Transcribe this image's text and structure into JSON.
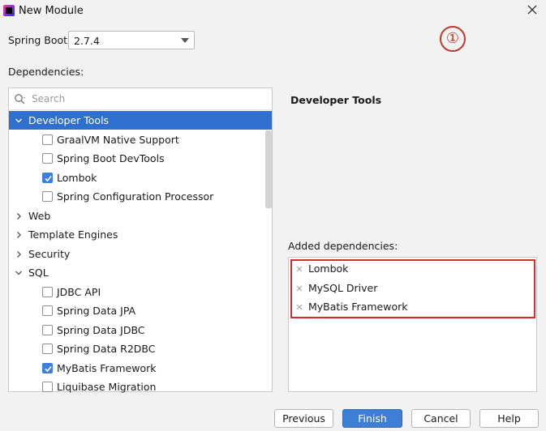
{
  "window": {
    "title": "New Module"
  },
  "spring_boot": {
    "label": "Spring Boot:",
    "value": "2.7.4"
  },
  "annotation": {
    "marker": "①"
  },
  "dependencies": {
    "label": "Dependencies:",
    "search_placeholder": "Search",
    "tree": [
      {
        "label": "Developer Tools",
        "type": "group",
        "expanded": true,
        "selected": true
      },
      {
        "label": "GraalVM Native Support",
        "type": "item",
        "checked": false
      },
      {
        "label": "Spring Boot DevTools",
        "type": "item",
        "checked": false
      },
      {
        "label": "Lombok",
        "type": "item",
        "checked": true
      },
      {
        "label": "Spring Configuration Processor",
        "type": "item",
        "checked": false
      },
      {
        "label": "Web",
        "type": "group",
        "expanded": false
      },
      {
        "label": "Template Engines",
        "type": "group",
        "expanded": false
      },
      {
        "label": "Security",
        "type": "group",
        "expanded": false
      },
      {
        "label": "SQL",
        "type": "group",
        "expanded": true
      },
      {
        "label": "JDBC API",
        "type": "item",
        "checked": false
      },
      {
        "label": "Spring Data JPA",
        "type": "item",
        "checked": false
      },
      {
        "label": "Spring Data JDBC",
        "type": "item",
        "checked": false
      },
      {
        "label": "Spring Data R2DBC",
        "type": "item",
        "checked": false
      },
      {
        "label": "MyBatis Framework",
        "type": "item",
        "checked": true
      },
      {
        "label": "Liquibase Migration",
        "type": "item",
        "checked": false
      }
    ]
  },
  "detail": {
    "title": "Developer Tools"
  },
  "added": {
    "label": "Added dependencies:",
    "items": [
      "Lombok",
      "MySQL Driver",
      "MyBatis Framework"
    ]
  },
  "buttons": {
    "previous": "Previous",
    "finish": "Finish",
    "cancel": "Cancel",
    "help": "Help"
  },
  "colors": {
    "selection": "#2f6fd0",
    "primary_button": "#3d7fd6",
    "highlight_box": "#d32f2f",
    "checkbox_checked": "#3c7fe0"
  }
}
